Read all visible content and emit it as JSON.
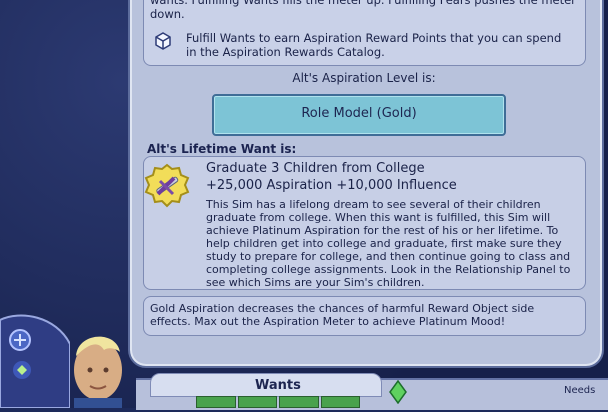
{
  "panel": {
    "top_cut_text": "wants. Fulfilling Wants fills the meter up. Fulfilling Fears pushes the meter down.",
    "fulfill_text": "Fulfill Wants to earn Aspiration Reward Points that you can spend in the Aspiration Rewards Catalog.",
    "aspiration_level_label": "Alt's Aspiration Level is:",
    "aspiration_level_value": "Role Model (Gold)",
    "lifetime_want_label": "Alt's Lifetime Want is:",
    "lifetime_want": {
      "title": "Graduate 3 Children from College",
      "points": "+25,000 Aspiration +10,000 Influence",
      "description": "This Sim has a lifelong dream to see several of their children graduate from college. When this want is fulfilled, this Sim will achieve Platinum Aspiration for the rest of his or her lifetime. To help children get into college and graduate, first make sure they study to prepare for college, and then continue going to class and completing college assignments. Look in the Relationship Panel to see which Sims are your Sim's children."
    },
    "gold_info": "Gold Aspiration decreases the chances of harmful Reward Object side effects. Max out the Aspiration Meter to achieve Platinum Mood!"
  },
  "hud": {
    "wants_label": "Wants",
    "needs_label": "Needs"
  },
  "colors": {
    "panel_bg": "#b8c2dc",
    "level_bar": "#7dc4d6",
    "accent_dark": "#1d2550"
  },
  "icons": {
    "catalog": "catalog-icon",
    "lifetime_badge": "graduation-badge-icon",
    "mood": "mood-diamond-icon"
  }
}
